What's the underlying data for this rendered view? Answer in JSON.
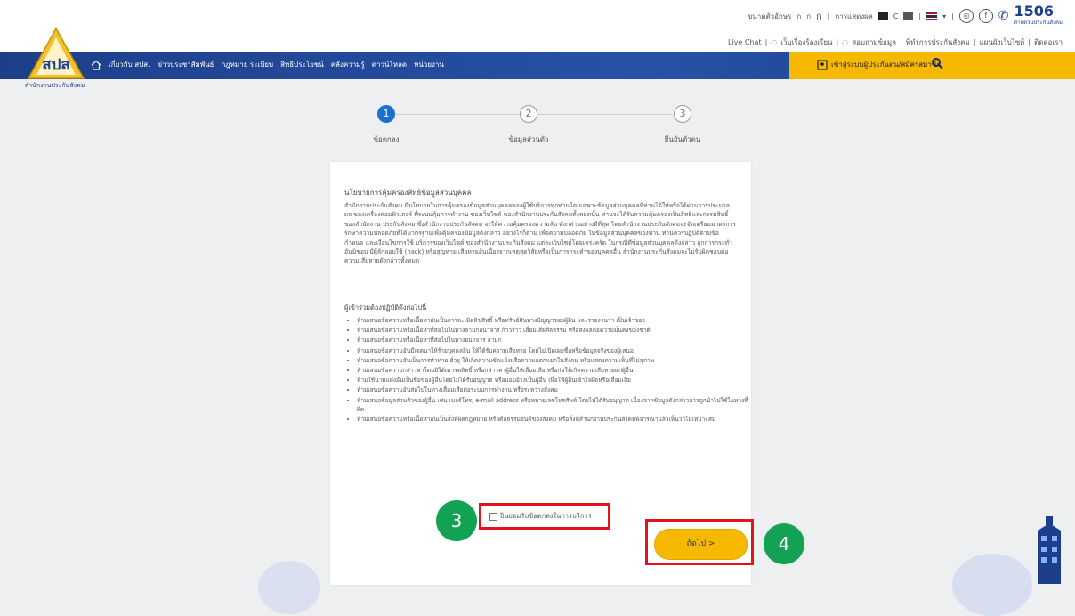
{
  "header": {
    "logo_caption": "สำนักงานประกันสังคม",
    "font_labels": [
      "ขนาดตัวอักษร",
      "ก",
      "ก",
      "ก"
    ],
    "contrast_label": "การแสดงผล",
    "contrast_c": "C",
    "hotline": "1506",
    "hotline_sub": "สายด่วนประกันสังคม",
    "util_links": [
      "Live Chat",
      "เว็บเรื่องร้องเรียน",
      "สอบถามข้อมูล",
      "ที่ทำการประกันสังคม",
      "แผนผังเว็บไซต์",
      "ติดต่อเรา"
    ],
    "accent_color": "#1d3f8a",
    "yellow": "#f6b800"
  },
  "nav": {
    "items": [
      "เกี่ยวกับ สปส.",
      "ข่าวประชาสัมพันธ์",
      "กฎหมาย ระเบียบ",
      "สิทธิประโยชน์",
      "คลังความรู้",
      "ดาวน์โหลด",
      "หน่วยงาน"
    ],
    "member_label": "เข้าสู่ระบบผู้ประกันตน/สมัครสมาชิก"
  },
  "stepper": {
    "steps": [
      {
        "num": "1",
        "label": "ข้อตกลง"
      },
      {
        "num": "2",
        "label": "ข้อมูลส่วนตัว"
      },
      {
        "num": "3",
        "label": "ยืนยันตัวตน"
      }
    ]
  },
  "card": {
    "title": "นโยบายการคุ้มครองสิทธิข้อมูลส่วนบุคคล",
    "paragraph": "สำนักงานประกันสังคม มีนโยบายในการคุ้มครองข้อมูลส่วนบุคคลของผู้ใช้บริการทุกท่านโดยเฉพาะข้อมูลส่วนบุคคลที่ท่านได้ให้หรือได้ผ่านการประมวลผล ของเครื่องคอมพิวเตอร์ ที่ระบบคุ้มการทำงาน ของเว็บไซต์ ของสำนักงานประกันสังคมทั้งหมดนั้น ท่านจะได้รับความคุ้มครองเป็นสิทธิและกรรมสิทธิ์ของสำนักงาน ประกันสังคม ซึ่งสำนักงานประกันสังคม จะให้ความคุ้มครองความลับ ดังกล่าวอย่างดีที่สุด โดยสำนักงานประกันสังคมจะจัดเตรียมมาตรการรักษาความปลอดภัยที่ได้มาตรฐานเพื่อคุ้มครองข้อมูลดังกล่าว อย่างไรก็ตาม เพื่อความปลอดภัย ในข้อมูลส่วนบุคคลของท่าน ท่านควรปฏิบัติตามข้อกำหนด และเงื่อนไขการใช้ บริการของเว็บไซต์ ของสำนักงานประกันสังคม แต่ละเว็บไซต์โดยเคร่งครัด ในกรณีที่ข้อมูลส่วนบุคคลดังกล่าว ถูกการกระทำอันมิชอบ มีผู้ลักลอบใช้ (hack) หรือสูญหาย เสียหายอันเนื่องจากเหตุสุดวิสัยหรือเป็นการกระทำของบุคคลอื่น สำนักงานประกันสังคมจะไม่รับผิดชอบต่อความเสียหายดังกล่าวทั้งหมด",
    "subheading": "ผู้เข้าร่วมต้องปฏิบัติดังต่อไปนี้",
    "rules": [
      "ห้ามเสนอข้อความหรือเนื้อหาอันเป็นการละเมิดลิขสิทธิ์ หรือทรัพย์สินทางปัญญาของผู้อื่น และรายงานว่า เป็นเจ้าของ",
      "ห้ามเสนอข้อความหรือเนื้อหาที่ส่อไปในทางลามกอนาจาร ก้าวร้าว เสื่อมเสียศีลธรรม หรือส่งผลต่อความมั่นคงของชาติ",
      "ห้ามเสนอข้อความหรือเนื้อหาที่ส่อไปในทางอนาจาร ลามก",
      "ห้ามเสนอข้อความอันมีเจตนาให้ร้ายบุคคลอื่น ให้ได้รับความเสียหาย โดยไม่เปิดเผยชื่อหรือข้อมูลจริงของผู้เสนอ",
      "ห้ามเสนอข้อความอันเป็นการท้าทาย ยั่วยุ ให้เกิดความขัดแย้งหรือความแตกแยกในสังคม หรือแสดงความเห็นที่ไม่สุภาพ",
      "ห้ามเสนอข้อความกล่าวหาโดยมิได้เคารพสิทธิ์ หรือกล่าวหาผู้อื่นให้เสื่อมเสีย หรือก่อให้เกิดความเสียหายแก่ผู้อื่น",
      "ห้ามใช้นามแฝงอันเป็นชื่อของผู้อื่นโดยไม่ได้รับอนุญาต หรือแอบอ้างเป็นผู้อื่น เพื่อให้ผู้อื่นเข้าใจผิดหรือเสื่อมเสีย",
      "ห้ามเสนอข้อความอันส่อไปในทางเสื่อมเสียต่อระบบการทำงาน หรือระหว่างสังคม",
      "ห้ามเสนอข้อมูลส่วนตัวของผู้อื่น เช่น เบอร์โทร, e-mail address หรือหมายเลขโทรศัพท์ โดยไม่ได้รับอนุญาต เนื่องจากข้อมูลดังกล่าวอาจถูกนำไปใช้ในทางที่ผิด",
      "ห้ามเสนอข้อความหรือเนื้อหาอันเป็นสิ่งที่ผิดกฎหมาย หรือศีลธรรมอันดีของสังคม หรือสิ่งที่สำนักงานประกันสังคมพิจารณาแล้วเห็นว่าไม่เหมาะสม"
    ],
    "accept_label": "ยินยอมรับข้อตกลงในการบริการ",
    "next_label": "ถัดไป >"
  },
  "annotations": {
    "badge_3": "3",
    "badge_4": "4",
    "highlight_color": "#e2131b",
    "badge_color": "#13a153"
  }
}
